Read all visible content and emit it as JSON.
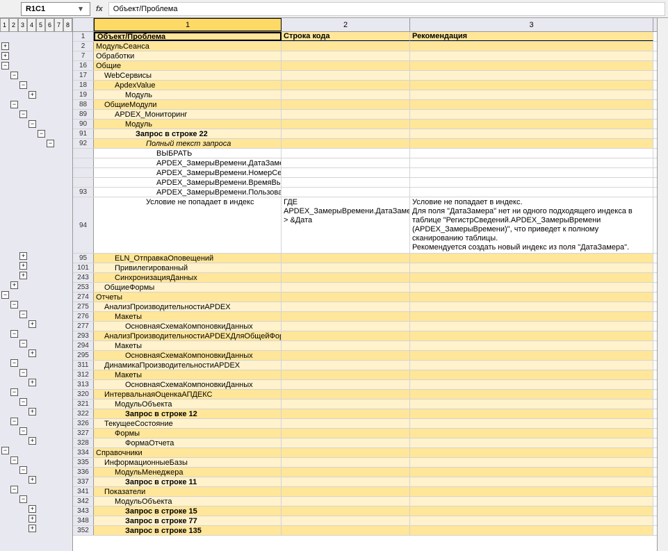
{
  "namebox": "R1C1",
  "fx_label": "fx",
  "formula": "Объект/Проблема",
  "outline_levels": [
    "1",
    "2",
    "3",
    "4",
    "5",
    "6",
    "7",
    "8"
  ],
  "colheaders": {
    "c1": "1",
    "c2": "2",
    "c3": "3"
  },
  "header": {
    "c1": "Объект/Проблема",
    "c2": "Строка кода",
    "c3": "Рекомендация"
  },
  "rows": [
    {
      "n": "2",
      "c1": "МодульСеанса",
      "ind": 0,
      "band": "band2"
    },
    {
      "n": "7",
      "c1": "Обработки",
      "ind": 0,
      "band": "band1"
    },
    {
      "n": "16",
      "c1": "Общие",
      "ind": 0,
      "band": "band2"
    },
    {
      "n": "17",
      "c1": "WebСервисы",
      "ind": 1,
      "band": "band1"
    },
    {
      "n": "18",
      "c1": "ApdexValue",
      "ind": 2,
      "band": "band2"
    },
    {
      "n": "19",
      "c1": "Модуль",
      "ind": 3,
      "band": "band1"
    },
    {
      "n": "88",
      "c1": "ОбщиеМодули",
      "ind": 1,
      "band": "band2"
    },
    {
      "n": "89",
      "c1": "APDEX_Мониторинг",
      "ind": 2,
      "band": "band1"
    },
    {
      "n": "90",
      "c1": "Модуль",
      "ind": 3,
      "band": "band2"
    },
    {
      "n": "91",
      "c1": "Запрос в строке 22",
      "ind": 4,
      "band": "band1",
      "bold": true
    },
    {
      "n": "92",
      "c1": "Полный текст запроса",
      "ind": 5,
      "band": "band2",
      "italic": true
    },
    {
      "n": "",
      "c1": "ВЫБРАТЬ",
      "ind": 6,
      "band": "white"
    },
    {
      "n": "",
      "c1": "APDEX_ЗамерыВремени.ДатаЗамера,",
      "ind": 6,
      "band": "white"
    },
    {
      "n": "",
      "c1": "APDEX_ЗамерыВремени.НомерСеанса КАК НомерСеанса,",
      "ind": 6,
      "band": "white"
    },
    {
      "n": "",
      "c1": "APDEX_ЗамерыВремени.ВремяВыполнения,",
      "ind": 6,
      "band": "white"
    },
    {
      "n": "93",
      "c1": "APDEX_ЗамерыВремени.Пользователь КАК ИмяПользователя,",
      "ind": 6,
      "band": "white"
    },
    {
      "n": "94",
      "c1": "Условие не попадает в индекс",
      "ind": 5,
      "c2": "ГДЕ\nAPDEX_ЗамерыВремени.ДатаЗамера > &Дата",
      "c3": "Условие не попадает в индекс.\nДля поля \"ДатаЗамера\" нет ни одного подходящего индекса в таблице \"РегистрСведений.APDEX_ЗамерыВремени (APDEX_ЗамерыВремени)\", что приведет к полному сканированию таблицы.\nРекомендуется создать новый индекс из поля \"ДатаЗамера\".",
      "band": "white",
      "tall": true
    },
    {
      "n": "95",
      "c1": "ELN_ОтправкаОповещений",
      "ind": 2,
      "band": "band2"
    },
    {
      "n": "101",
      "c1": "Привилегированный",
      "ind": 2,
      "band": "band1"
    },
    {
      "n": "243",
      "c1": "СинхронизацияДанных",
      "ind": 2,
      "band": "band2"
    },
    {
      "n": "253",
      "c1": "ОбщиеФормы",
      "ind": 1,
      "band": "band1"
    },
    {
      "n": "274",
      "c1": "Отчеты",
      "ind": 0,
      "band": "band2"
    },
    {
      "n": "275",
      "c1": "АнализПроизводительностиAPDEX",
      "ind": 1,
      "band": "band1"
    },
    {
      "n": "276",
      "c1": "Макеты",
      "ind": 2,
      "band": "band2"
    },
    {
      "n": "277",
      "c1": "ОсновнаяСхемаКомпоновкиДанных",
      "ind": 3,
      "band": "band1"
    },
    {
      "n": "293",
      "c1": "АнализПроизводительностиAPDEXДляОбщейФормы",
      "ind": 1,
      "band": "band2"
    },
    {
      "n": "294",
      "c1": "Макеты",
      "ind": 2,
      "band": "band1"
    },
    {
      "n": "295",
      "c1": "ОсновнаяСхемаКомпоновкиДанных",
      "ind": 3,
      "band": "band2"
    },
    {
      "n": "311",
      "c1": "ДинамикаПроизводительностиAPDEX",
      "ind": 1,
      "band": "band1"
    },
    {
      "n": "312",
      "c1": "Макеты",
      "ind": 2,
      "band": "band2"
    },
    {
      "n": "313",
      "c1": "ОсновнаяСхемаКомпоновкиДанных",
      "ind": 3,
      "band": "band1"
    },
    {
      "n": "320",
      "c1": "ИнтервальнаяОценкаАПДЕКС",
      "ind": 1,
      "band": "band2"
    },
    {
      "n": "321",
      "c1": "МодульОбъекта",
      "ind": 2,
      "band": "band1"
    },
    {
      "n": "322",
      "c1": "Запрос в строке 12",
      "ind": 3,
      "band": "band2",
      "bold": true
    },
    {
      "n": "326",
      "c1": "ТекущееСостояние",
      "ind": 1,
      "band": "band1"
    },
    {
      "n": "327",
      "c1": "Формы",
      "ind": 2,
      "band": "band2"
    },
    {
      "n": "328",
      "c1": "ФормаОтчета",
      "ind": 3,
      "band": "band1"
    },
    {
      "n": "334",
      "c1": "Справочники",
      "ind": 0,
      "band": "band2"
    },
    {
      "n": "335",
      "c1": "ИнформационныеБазы",
      "ind": 1,
      "band": "band1"
    },
    {
      "n": "336",
      "c1": "МодульМенеджера",
      "ind": 2,
      "band": "band2"
    },
    {
      "n": "337",
      "c1": "Запрос в строке 11",
      "ind": 3,
      "band": "band1",
      "bold": true
    },
    {
      "n": "341",
      "c1": "Показатели",
      "ind": 1,
      "band": "band2"
    },
    {
      "n": "342",
      "c1": "МодульОбъекта",
      "ind": 2,
      "band": "band1"
    },
    {
      "n": "343",
      "c1": "Запрос в строке 15",
      "ind": 3,
      "band": "band2",
      "bold": true
    },
    {
      "n": "348",
      "c1": "Запрос в строке 77",
      "ind": 3,
      "band": "band1",
      "bold": true
    },
    {
      "n": "352",
      "c1": "Запрос в строке 135",
      "ind": 3,
      "band": "band2",
      "bold": true
    }
  ],
  "outline_buttons": [
    {
      "row": 1,
      "col": 0,
      "sym": "+"
    },
    {
      "row": 2,
      "col": 0,
      "sym": "+"
    },
    {
      "row": 3,
      "col": 0,
      "sym": "−"
    },
    {
      "row": 4,
      "col": 1,
      "sym": "−"
    },
    {
      "row": 5,
      "col": 2,
      "sym": "−"
    },
    {
      "row": 6,
      "col": 3,
      "sym": "+"
    },
    {
      "row": 7,
      "col": 1,
      "sym": "−"
    },
    {
      "row": 8,
      "col": 2,
      "sym": "−"
    },
    {
      "row": 9,
      "col": 3,
      "sym": "−"
    },
    {
      "row": 10,
      "col": 4,
      "sym": "−"
    },
    {
      "row": 11,
      "col": 5,
      "sym": "−"
    },
    {
      "row": 18,
      "col": 2,
      "sym": "+"
    },
    {
      "row": 19,
      "col": 2,
      "sym": "+"
    },
    {
      "row": 20,
      "col": 2,
      "sym": "+"
    },
    {
      "row": 21,
      "col": 1,
      "sym": "+"
    },
    {
      "row": 22,
      "col": 0,
      "sym": "−"
    },
    {
      "row": 23,
      "col": 1,
      "sym": "−"
    },
    {
      "row": 24,
      "col": 2,
      "sym": "−"
    },
    {
      "row": 25,
      "col": 3,
      "sym": "+"
    },
    {
      "row": 26,
      "col": 1,
      "sym": "−"
    },
    {
      "row": 27,
      "col": 2,
      "sym": "−"
    },
    {
      "row": 28,
      "col": 3,
      "sym": "+"
    },
    {
      "row": 29,
      "col": 1,
      "sym": "−"
    },
    {
      "row": 30,
      "col": 2,
      "sym": "−"
    },
    {
      "row": 31,
      "col": 3,
      "sym": "+"
    },
    {
      "row": 32,
      "col": 1,
      "sym": "−"
    },
    {
      "row": 33,
      "col": 2,
      "sym": "−"
    },
    {
      "row": 34,
      "col": 3,
      "sym": "+"
    },
    {
      "row": 35,
      "col": 1,
      "sym": "−"
    },
    {
      "row": 36,
      "col": 2,
      "sym": "−"
    },
    {
      "row": 37,
      "col": 3,
      "sym": "+"
    },
    {
      "row": 38,
      "col": 0,
      "sym": "−"
    },
    {
      "row": 39,
      "col": 1,
      "sym": "−"
    },
    {
      "row": 40,
      "col": 2,
      "sym": "−"
    },
    {
      "row": 41,
      "col": 3,
      "sym": "+"
    },
    {
      "row": 42,
      "col": 1,
      "sym": "−"
    },
    {
      "row": 43,
      "col": 2,
      "sym": "−"
    },
    {
      "row": 44,
      "col": 3,
      "sym": "+"
    },
    {
      "row": 45,
      "col": 3,
      "sym": "+"
    },
    {
      "row": 46,
      "col": 3,
      "sym": "+"
    }
  ]
}
